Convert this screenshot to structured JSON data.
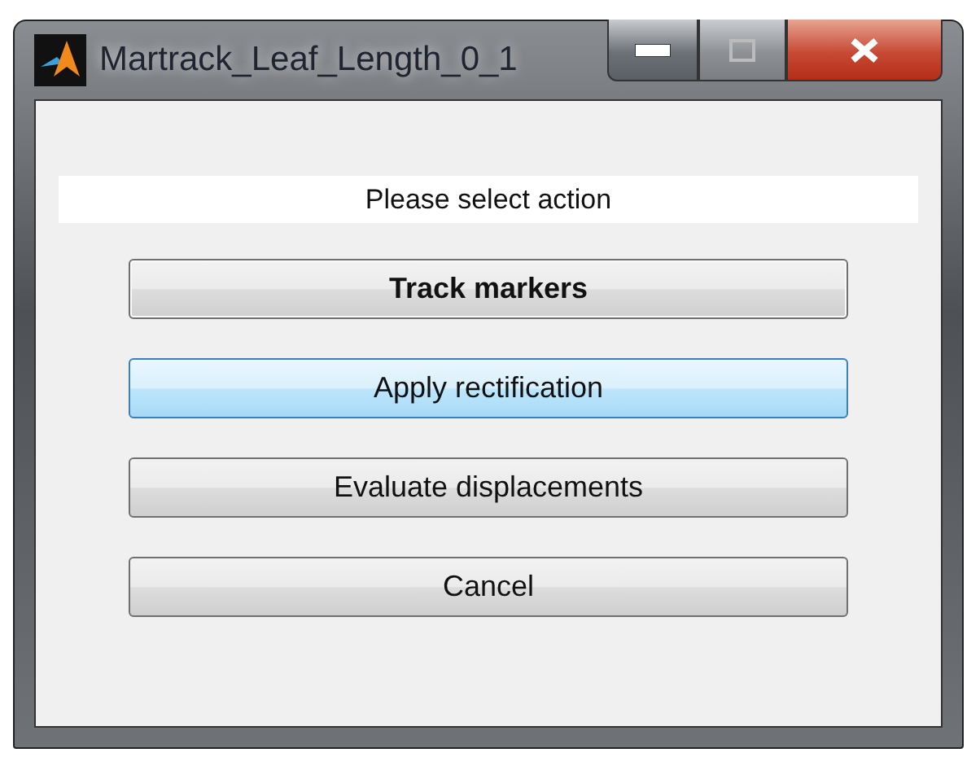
{
  "window": {
    "title": "Martrack_Leaf_Length_0_1"
  },
  "prompt": "Please select action",
  "buttons": [
    {
      "label": "Track markers",
      "default": true,
      "hovered": false
    },
    {
      "label": "Apply rectification",
      "default": false,
      "hovered": true
    },
    {
      "label": "Evaluate displacements",
      "default": false,
      "hovered": false
    },
    {
      "label": "Cancel",
      "default": false,
      "hovered": false
    }
  ]
}
